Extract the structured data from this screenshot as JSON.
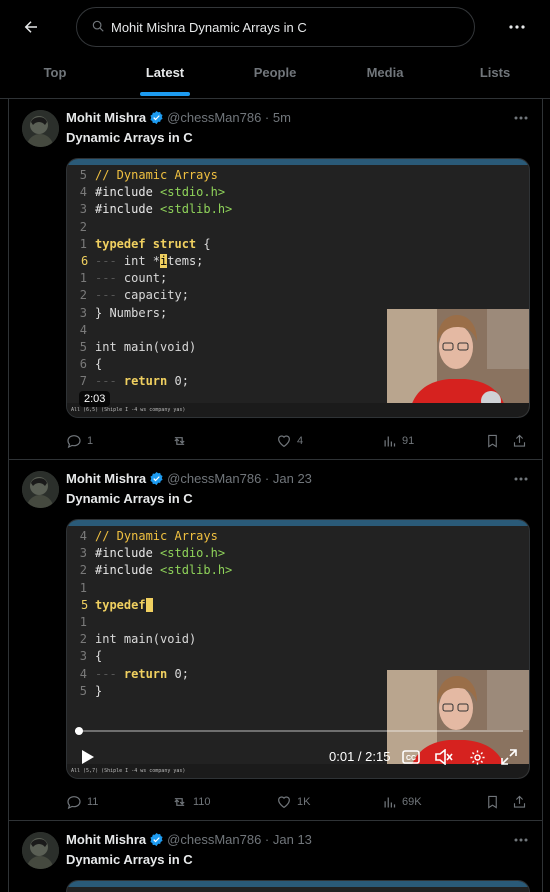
{
  "search": {
    "value": "Mohit Mishra Dynamic Arrays in C"
  },
  "tabs": [
    {
      "label": "Top"
    },
    {
      "label": "Latest"
    },
    {
      "label": "People"
    },
    {
      "label": "Media"
    },
    {
      "label": "Lists"
    }
  ],
  "active_tab": "Latest",
  "colors": {
    "accent": "#1d9bf0",
    "verified": "#1d9bf0",
    "muted": "#71767b",
    "border": "#2f3336"
  },
  "tweets": [
    {
      "name": "Mohit Mishra",
      "handle": "@chessMan786",
      "time": "5m",
      "text": "Dynamic Arrays in C",
      "duration": "2:03",
      "replies": "1",
      "retweets": "",
      "likes": "4",
      "views": "91",
      "status_text": "All (6,5)    (Shiple I -4 ws company yas)"
    },
    {
      "name": "Mohit Mishra",
      "handle": "@chessMan786",
      "time": "Jan 23",
      "text": "Dynamic Arrays in C",
      "time_display": "0:01 / 2:15",
      "progress": 0.008,
      "replies": "11",
      "retweets": "110",
      "likes": "1K",
      "views": "69K",
      "status_text": "All (5,7)    (Shiple I -4 ws company yas)"
    },
    {
      "name": "Mohit Mishra",
      "handle": "@chessMan786",
      "time": "Jan 13",
      "text": "Dynamic Arrays in C"
    }
  ],
  "code1": {
    "lines": [
      {
        "n": "5",
        "html": "<span class='c-com'>// Dynamic Arrays</span>"
      },
      {
        "n": "4",
        "html": "<span class='c-inc'>#include </span><span class='c-str'>&lt;stdio.h&gt;</span>"
      },
      {
        "n": "3",
        "html": "<span class='c-inc'>#include </span><span class='c-str'>&lt;stdlib.h&gt;</span>"
      },
      {
        "n": "2",
        "html": ""
      },
      {
        "n": "1",
        "html": "<span class='c-kw'>typedef struct</span><span class='c-txt'> {</span>"
      },
      {
        "n": "6",
        "cur": true,
        "html": "<span class='c-dot'>---</span><span class='c-ty'> int *</span><span class='cursor'>i</span><span class='c-txt'>tems;</span>"
      },
      {
        "n": "1",
        "html": "<span class='c-dot'>---</span><span class='c-ty'> count;</span>"
      },
      {
        "n": "2",
        "html": "<span class='c-dot'>---</span><span class='c-ty'> capacity;</span>"
      },
      {
        "n": "3",
        "html": "<span class='c-txt'>} Numbers;</span>"
      },
      {
        "n": "4",
        "html": ""
      },
      {
        "n": "5",
        "html": "<span class='c-ty'>int </span><span class='c-txt'>main(</span><span class='c-ty'>void</span><span class='c-txt'>)</span>"
      },
      {
        "n": "6",
        "html": "<span class='c-txt'>{</span>"
      },
      {
        "n": "7",
        "html": "<span class='c-dot'>---</span><span class='c-kw'> return</span><span class='c-txt'> 0;</span>"
      }
    ]
  },
  "code2": {
    "lines": [
      {
        "n": "4",
        "html": "<span class='c-com'>// Dynamic Arrays</span>"
      },
      {
        "n": "3",
        "html": "<span class='c-inc'>#include </span><span class='c-str'>&lt;stdio.h&gt;</span>"
      },
      {
        "n": "2",
        "html": "<span class='c-inc'>#include </span><span class='c-str'>&lt;stdlib.h&gt;</span>"
      },
      {
        "n": "1",
        "html": ""
      },
      {
        "n": "5",
        "cur": true,
        "html": "<span class='c-kw'>typedef</span><span class='cursor'>&nbsp;</span>"
      },
      {
        "n": "1",
        "html": ""
      },
      {
        "n": "2",
        "html": "<span class='c-ty'>int </span><span class='c-txt'>main(</span><span class='c-ty'>void</span><span class='c-txt'>)</span>"
      },
      {
        "n": "3",
        "html": "<span class='c-txt'>{</span>"
      },
      {
        "n": "4",
        "html": "<span class='c-dot'>---</span><span class='c-kw'> return</span><span class='c-txt'> 0;</span>"
      },
      {
        "n": "5",
        "html": "<span class='c-txt'>}</span>"
      }
    ]
  }
}
